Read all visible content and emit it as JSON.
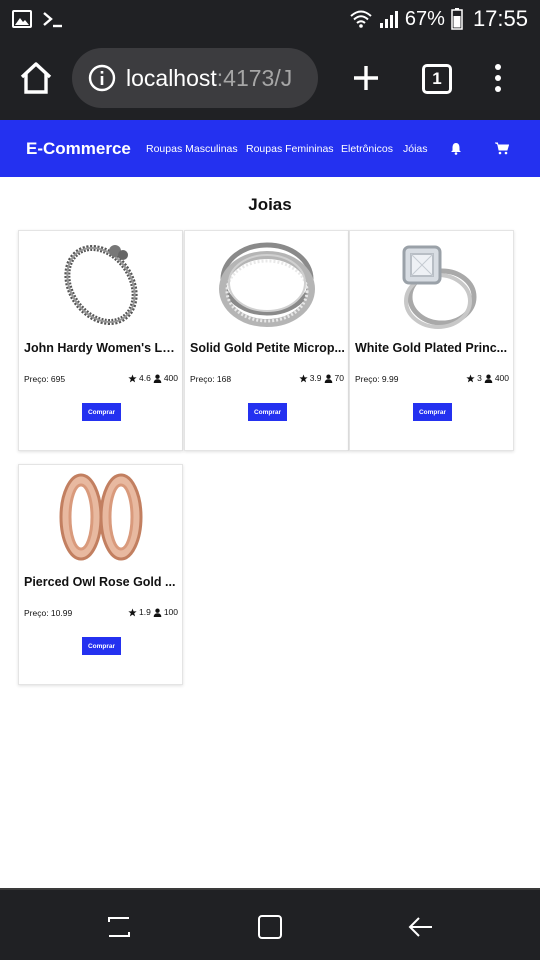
{
  "status": {
    "battery": "67%",
    "time": "17:55"
  },
  "browser": {
    "url_host": "localhost",
    "url_rest": ":4173/J",
    "tab_count": "1"
  },
  "nav": {
    "brand": "E-Commerce",
    "links": [
      "Roupas Masculinas",
      "Roupas Femininas",
      "Eletrônicos",
      "Jóias"
    ]
  },
  "page": {
    "title": "Joias"
  },
  "products": [
    {
      "name": "John Hardy Women's Le...",
      "price": "Preço: 695",
      "rating": "4.6",
      "count": "400",
      "button": "Comprar"
    },
    {
      "name": "Solid Gold Petite Microp...",
      "price": "Preço: 168",
      "rating": "3.9",
      "count": "70",
      "button": "Comprar"
    },
    {
      "name": "White Gold Plated Princ...",
      "price": "Preço: 9.99",
      "rating": "3",
      "count": "400",
      "button": "Comprar"
    },
    {
      "name": "Pierced Owl Rose Gold ...",
      "price": "Preço: 10.99",
      "rating": "1.9",
      "count": "100",
      "button": "Comprar"
    }
  ],
  "colors": {
    "navbar": "#2431f0",
    "system_bars": "#202124"
  }
}
